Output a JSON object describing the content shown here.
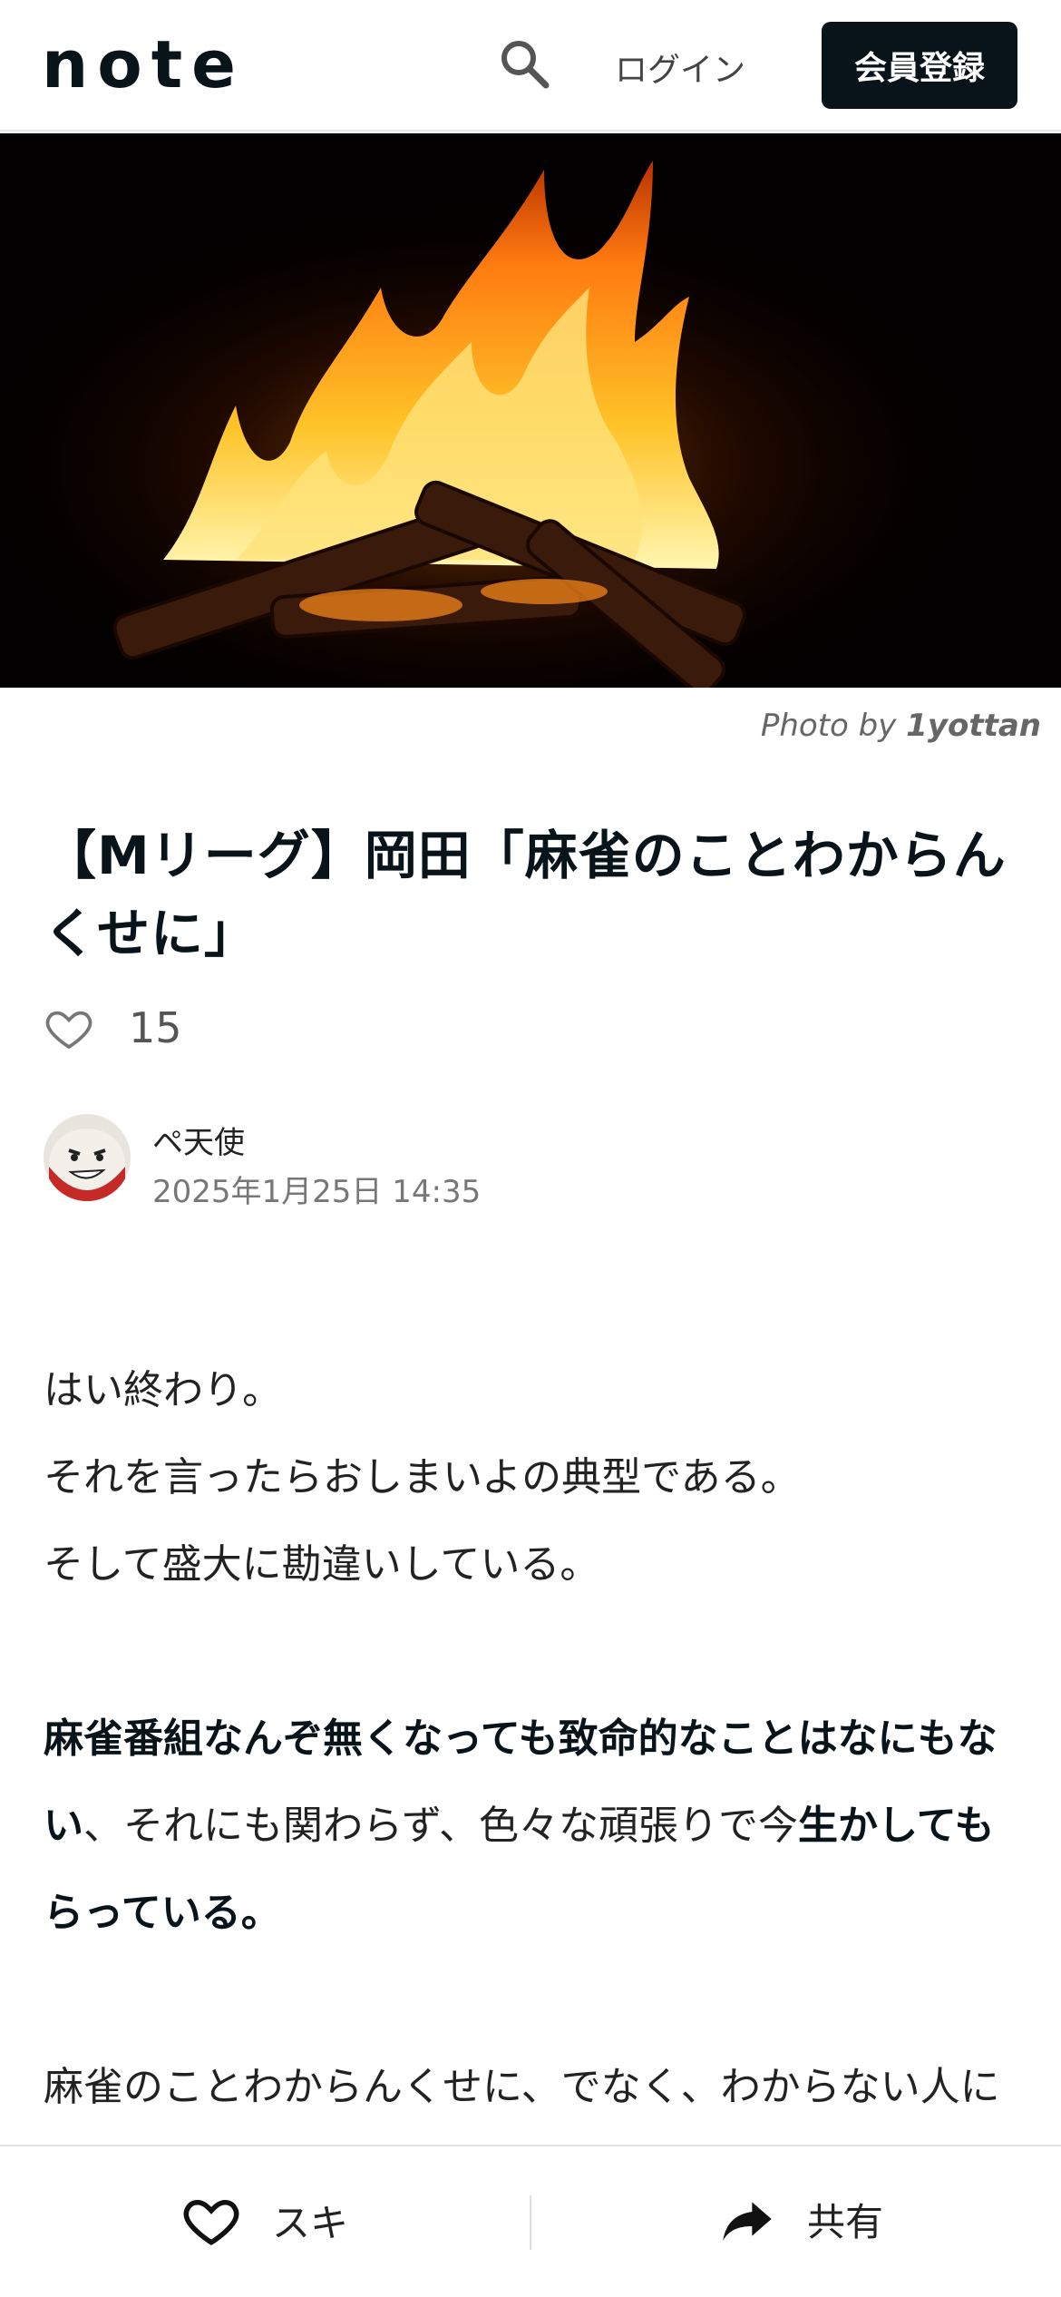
{
  "header": {
    "logo_text": "note",
    "login_label": "ログイン",
    "signup_label": "会員登録"
  },
  "photo_credit": {
    "prefix": "Photo by",
    "author": "1yottan"
  },
  "article": {
    "title": "【Mリーグ】岡田「麻雀のことわからんくせに」",
    "like_count": "15",
    "author_name": "ペ天使",
    "published": "2025年1月25日 14:35",
    "p1": [
      "はい終わり。",
      "それを言ったらおしまいよの典型である。",
      "そして盛大に勘違いしている。"
    ],
    "p2_bold_a": "麻雀番組なんぞ無くなっても致命的なことはなにもない",
    "p2_normal": "、それにも関わらず、色々な頑張りで今",
    "p2_bold_b": "生かしてもらっている。",
    "p3_visible": "麻雀のことわからんくせに、でなく、わからない人にわかりたくなる麻雀が魅せられない能力の低"
  },
  "bottom_bar": {
    "like_label": "スキ",
    "share_label": "共有"
  },
  "icons": [
    "search-icon",
    "heart-icon",
    "share-icon",
    "avatar"
  ],
  "colors": {
    "primary": "#08131a",
    "text": "#222222",
    "muted": "#777777"
  }
}
